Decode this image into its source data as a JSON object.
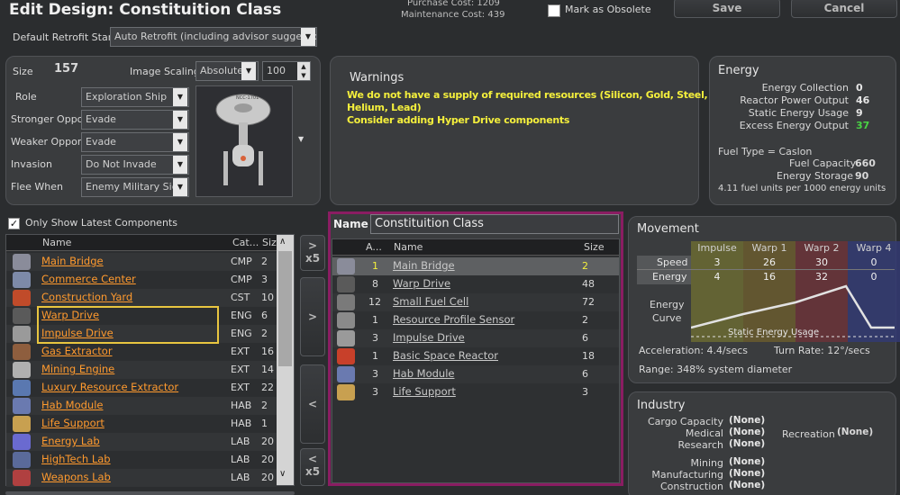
{
  "title": "Edit Design: Constituition Class",
  "purchase_cost": "Purchase Cost: 1209",
  "maintenance_cost": "Maintenance Cost: 439",
  "mark_obsolete": "Mark as Obsolete",
  "save_label": "Save",
  "cancel_label": "Cancel",
  "retrofit": {
    "label": "Default Retrofit Stance",
    "value": "Auto Retrofit (including advisor suggestions"
  },
  "design": {
    "size_label": "Size",
    "size_value": "157",
    "image_scaling_label": "Image Scaling",
    "image_scaling_value": "Absolute",
    "scale_value": "100",
    "fields": [
      {
        "label": "Role",
        "value": "Exploration Ship"
      },
      {
        "label": "Stronger Opponents",
        "value": "Evade"
      },
      {
        "label": "Weaker Opponents",
        "value": "Evade"
      },
      {
        "label": "Invasion",
        "value": "Do Not Invade"
      },
      {
        "label": "Flee When",
        "value": "Enemy Military Sigh"
      }
    ]
  },
  "warnings": {
    "title": "Warnings",
    "lines": [
      "We do not have a supply of required resources (Silicon, Gold, Steel,",
      "Helium, Lead)",
      "Consider adding Hyper Drive components"
    ]
  },
  "energy": {
    "title": "Energy",
    "rows": [
      {
        "label": "Energy Collection",
        "value": "0"
      },
      {
        "label": "Reactor Power Output",
        "value": "46"
      },
      {
        "label": "Static Energy Usage",
        "value": "9"
      },
      {
        "label": "Excess Energy Output",
        "value": "37"
      }
    ],
    "fuel_type": "Fuel Type = Caslon",
    "fuel_capacity_label": "Fuel Capacity",
    "fuel_capacity_value": "660",
    "energy_storage_label": "Energy Storage",
    "energy_storage_value": "90",
    "fuel_note": "4.11 fuel units per 1000 energy units"
  },
  "components": {
    "only_latest": "Only Show Latest Components",
    "headers": [
      "Name",
      "Cat...",
      "Size"
    ],
    "rows": [
      {
        "name": "Main Bridge",
        "cat": "CMP",
        "size": "2"
      },
      {
        "name": "Commerce Center",
        "cat": "CMP",
        "size": "3"
      },
      {
        "name": "Construction Yard",
        "cat": "CST",
        "size": "10"
      },
      {
        "name": "Warp Drive",
        "cat": "ENG",
        "size": "6"
      },
      {
        "name": "Impulse Drive",
        "cat": "ENG",
        "size": "2"
      },
      {
        "name": "Gas Extractor",
        "cat": "EXT",
        "size": "16"
      },
      {
        "name": "Mining Engine",
        "cat": "EXT",
        "size": "14"
      },
      {
        "name": "Luxury Resource Extractor",
        "cat": "EXT",
        "size": "22"
      },
      {
        "name": "Hab Module",
        "cat": "HAB",
        "size": "2"
      },
      {
        "name": "Life Support",
        "cat": "HAB",
        "size": "1"
      },
      {
        "name": "Energy Lab",
        "cat": "LAB",
        "size": "20"
      },
      {
        "name": "HighTech Lab",
        "cat": "LAB",
        "size": "20"
      },
      {
        "name": "Weapons Lab",
        "cat": "LAB",
        "size": "20"
      }
    ]
  },
  "transfer": {
    "x5": "x5",
    "add": ">",
    "remove": "<",
    "x5b": "x5",
    "add5": ">"
  },
  "ship": {
    "name_label": "Name",
    "name_value": "Constituition Class",
    "headers": [
      "A...",
      "Name",
      "Size"
    ],
    "rows": [
      {
        "amount": "1",
        "name": "Main Bridge",
        "size": "2"
      },
      {
        "amount": "8",
        "name": "Warp Drive",
        "size": "48"
      },
      {
        "amount": "12",
        "name": "Small Fuel Cell",
        "size": "72"
      },
      {
        "amount": "1",
        "name": "Resource Profile Sensor",
        "size": "2"
      },
      {
        "amount": "3",
        "name": "Impulse Drive",
        "size": "6"
      },
      {
        "amount": "1",
        "name": "Basic Space Reactor",
        "size": "18"
      },
      {
        "amount": "3",
        "name": "Hab Module",
        "size": "6"
      },
      {
        "amount": "3",
        "name": "Life Support",
        "size": "3"
      }
    ]
  },
  "movement": {
    "title": "Movement",
    "columns": [
      "Impulse",
      "Warp 1",
      "Warp 2",
      "Warp 4"
    ],
    "speed_label": "Speed",
    "speed": [
      "3",
      "26",
      "30",
      "0"
    ],
    "energy_label": "Energy",
    "energy": [
      "4",
      "16",
      "32",
      "0"
    ],
    "curve_label_1": "Energy",
    "curve_label_2": "Curve",
    "static_usage": "Static Energy Usage",
    "acceleration": "Acceleration: 4.4/secs",
    "turn_rate": "Turn Rate: 12°/secs",
    "range": "Range: 348% system diameter",
    "colors": {
      "impulse": "#6b6a32",
      "warp1": "#6a5b2e",
      "warp2": "#6b3238",
      "warp4": "#333a72"
    }
  },
  "industry": {
    "title": "Industry",
    "left": [
      {
        "label": "Cargo Capacity",
        "value": "(None)"
      },
      {
        "label": "Medical",
        "value": "(None)"
      },
      {
        "label": "Research",
        "value": "(None)"
      }
    ],
    "recreation_label": "Recreation",
    "recreation_value": "(None)",
    "left2": [
      {
        "label": "Mining",
        "value": "(None)"
      },
      {
        "label": "Manufacturing",
        "value": "(None)"
      },
      {
        "label": "Construction",
        "value": "(None)"
      }
    ]
  }
}
